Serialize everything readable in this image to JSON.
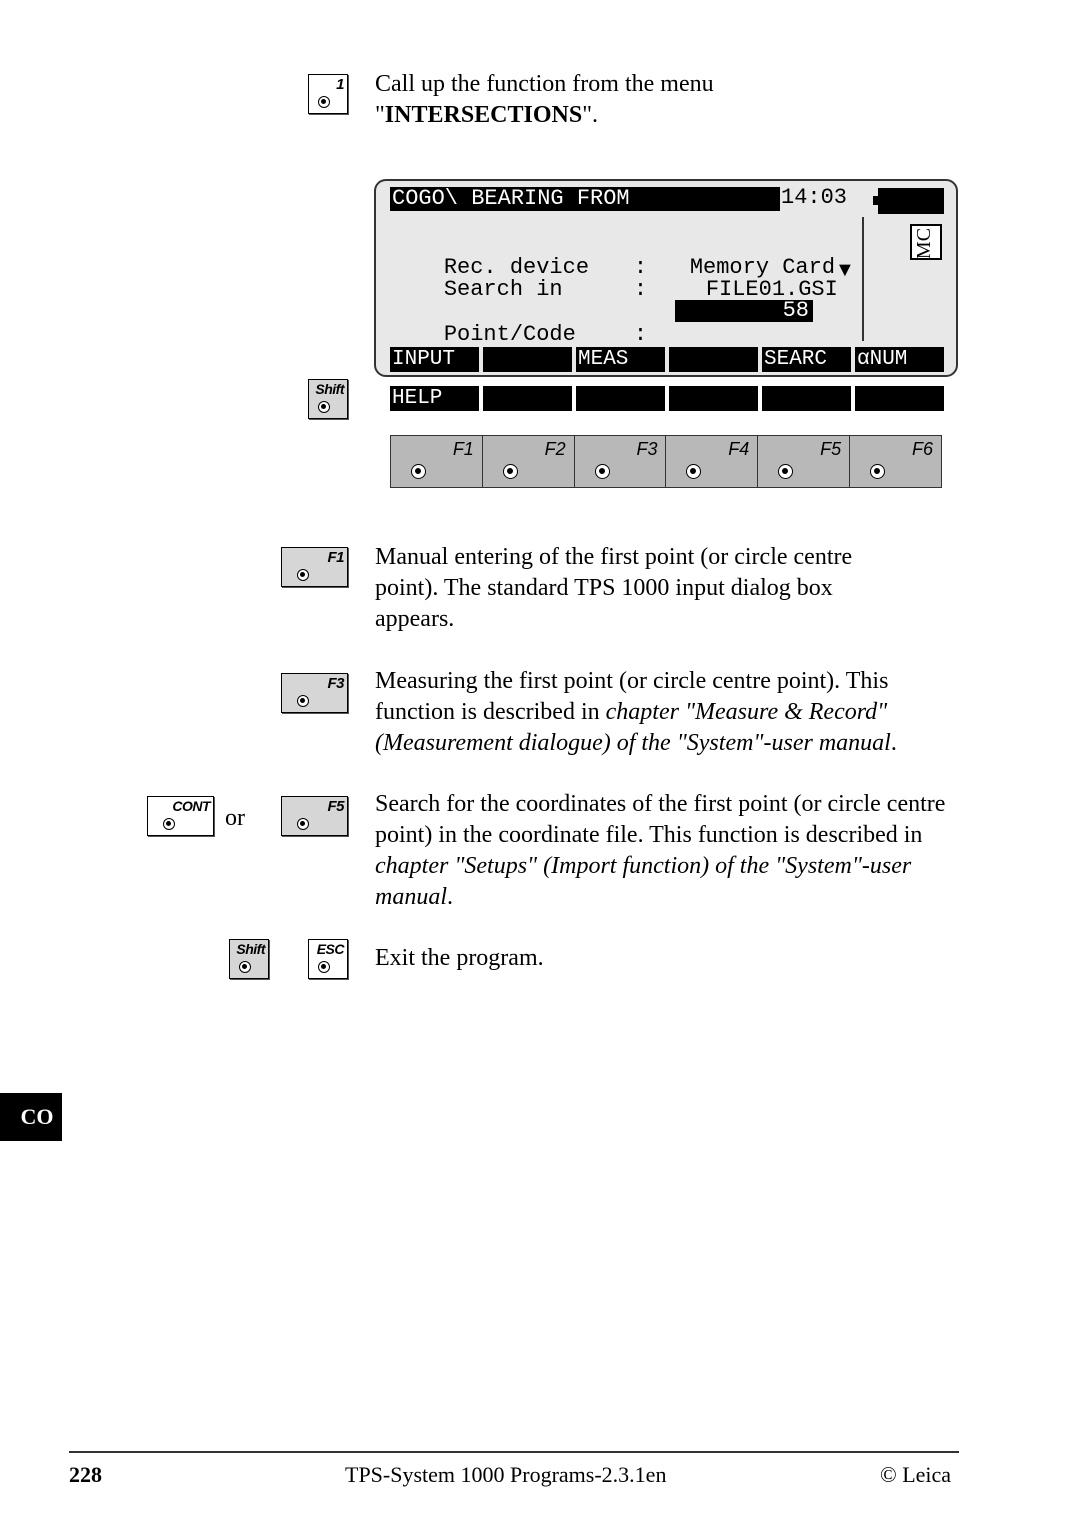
{
  "step1": {
    "key_label": "1",
    "text_before": "Call up the function from the menu",
    "quote_open": "\"",
    "menu_name": "INTERSECTIONS",
    "quote_close": "\"."
  },
  "display": {
    "title": "COGO\\ BEARING FROM",
    "time": "14:03",
    "mc_badge": "MC",
    "rows": [
      {
        "label": "Rec. device",
        "colon": ":",
        "value": "Memory Card"
      },
      {
        "label": "Search in",
        "colon": ":",
        "value": "FILE01.GSI"
      }
    ],
    "arrow": "▼",
    "point_label": "Point/Code",
    "point_colon": ":",
    "point_value": "58",
    "softkeys": [
      "INPUT",
      "",
      "MEAS",
      "",
      "SEARC",
      "αNUM"
    ],
    "shift_softkeys": [
      "HELP",
      "",
      "",
      "",
      "",
      ""
    ]
  },
  "shift_key_label": "Shift",
  "fkeys": [
    "F1",
    "F2",
    "F3",
    "F4",
    "F5",
    "F6"
  ],
  "instructions": [
    {
      "keys": [
        "F1"
      ],
      "text": "Manual entering of the first point (or circle centre point). The standard TPS 1000 input dialog box appears."
    },
    {
      "keys": [
        "F3"
      ],
      "text_plain": "Measuring the first point (or circle centre point). This function is described in ",
      "text_italic": "chapter \"Measure & Record\" (Measurement dialogue) of the \"System\"-user manual",
      "text_end": "."
    },
    {
      "keys": [
        "CONT",
        "F5"
      ],
      "or": "or",
      "text_plain": "Search for the coordinates of the first point (or circle centre point) in the coordinate file. This function is described in ",
      "text_italic": "chapter \"Setups\" (Import function) of the \"System\"-user manual",
      "text_end": "."
    },
    {
      "keys": [
        "Shift",
        "ESC"
      ],
      "text": "Exit the program."
    }
  ],
  "side_tab": "CO",
  "footer": {
    "page_number": "228",
    "title": "TPS-System 1000 Programs-2.3.1en",
    "copyright": "© Leica"
  }
}
